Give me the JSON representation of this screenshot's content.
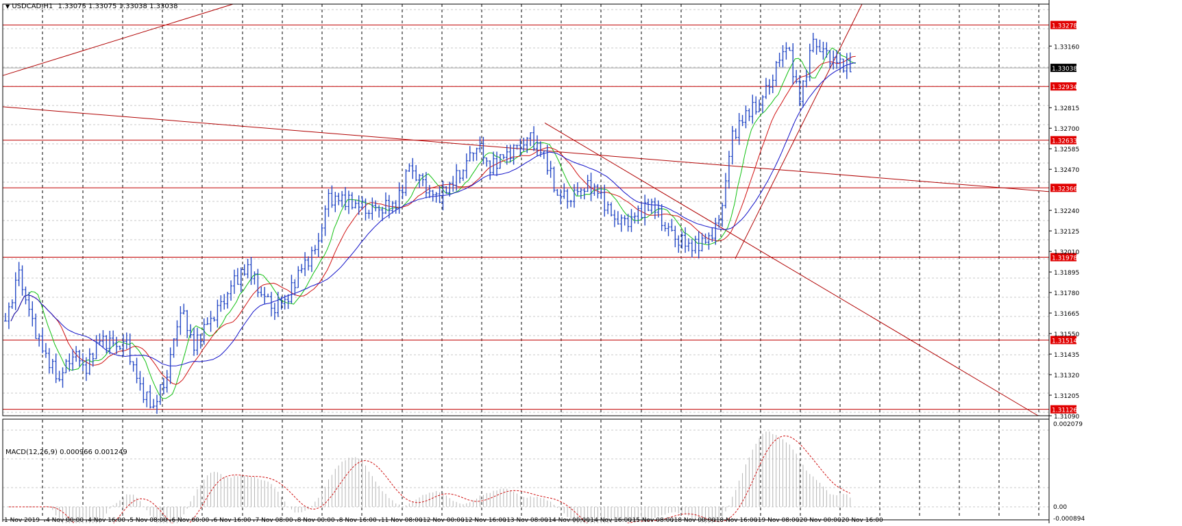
{
  "header": {
    "arrow": "▼",
    "symbol": "USDCAD,H1",
    "ohlc": "1.33075 1.33075 1.33038 1.33038"
  },
  "macd_panel": {
    "label": "MACD(12,26,9) 0.000966 0.001249",
    "scale_labels": [
      "0.002079",
      "0.00",
      "-0.000894"
    ]
  },
  "colors": {
    "candle": "#2448c5",
    "ma_fast": "#10c010",
    "ma_mid": "#d01010",
    "ma_slow": "#1010c8",
    "hline": "#c00000",
    "trend": "#b00000",
    "grid": "#c8c8c8",
    "vgrid": "#000000",
    "current_label_bg": "#000000",
    "hline_label_bg": "#e00000",
    "macd_hist": "#b4b4b4",
    "macd_signal": "#d01010"
  },
  "chart_data": {
    "type": "line",
    "title": "USDCAD,H1",
    "current_price": "1.33038",
    "ylim": [
      1.3109,
      1.33395
    ],
    "price_scale_labels": [
      "1.33160",
      "1.32815",
      "1.32700",
      "1.32585",
      "1.32470",
      "1.32240",
      "1.32125",
      "1.32010",
      "1.31895",
      "1.31780",
      "1.31665",
      "1.31550",
      "1.31435",
      "1.31320",
      "1.31205",
      "1.31090"
    ],
    "horizontal_levels": [
      "1.33278",
      "1.32934",
      "1.32633",
      "1.32366",
      "1.31978",
      "1.31514",
      "1.31126"
    ],
    "time_labels": [
      "1 Nov 2019",
      "4 Nov 00:00",
      "4 Nov 16:00",
      "5 Nov 08:00",
      "6 Nov 00:00",
      "6 Nov 16:00",
      "7 Nov 08:00",
      "8 Nov 00:00",
      "8 Nov 16:00",
      "11 Nov 08:00",
      "12 Nov 00:00",
      "12 Nov 16:00",
      "13 Nov 08:00",
      "14 Nov 00:00",
      "14 Nov 16:00",
      "15 Nov 08:00",
      "18 Nov 00:00",
      "18 Nov 16:00",
      "19 Nov 08:00",
      "20 Nov 00:00",
      "20 Nov 16:00"
    ],
    "price_series": [
      [
        1.3162,
        1.31598
      ],
      [
        1.3188,
        1.3172
      ],
      [
        1.316,
        1.3156
      ],
      [
        1.3142,
        1.3138
      ],
      [
        1.313,
        1.3128
      ],
      [
        1.3145,
        1.3148
      ],
      [
        1.3136,
        1.3138
      ],
      [
        1.3152,
        1.3146
      ],
      [
        1.3148,
        1.3142
      ],
      [
        1.3148,
        1.31495
      ],
      [
        1.3124,
        1.3123
      ],
      [
        1.3114,
        1.311
      ],
      [
        1.3133,
        1.3128
      ],
      [
        1.317,
        1.316
      ],
      [
        1.3148,
        1.3144
      ],
      [
        1.316,
        1.3164
      ],
      [
        1.317,
        1.3172
      ],
      [
        1.3184,
        1.3186
      ],
      [
        1.3192,
        1.319
      ],
      [
        1.3178,
        1.3176
      ],
      [
        1.317,
        1.3166
      ],
      [
        1.3176,
        1.3178
      ],
      [
        1.3192,
        1.3195
      ],
      [
        1.32,
        1.3205
      ],
      [
        1.323,
        1.3235
      ],
      [
        1.323,
        1.3232
      ],
      [
        1.3228,
        1.323
      ],
      [
        1.3225,
        1.3223
      ],
      [
        1.3226,
        1.3224
      ],
      [
        1.3227,
        1.3229
      ],
      [
        1.3248,
        1.3249
      ],
      [
        1.3238,
        1.324
      ],
      [
        1.323,
        1.3232
      ],
      [
        1.3238,
        1.3237
      ],
      [
        1.3248,
        1.325
      ],
      [
        1.3262,
        1.3263
      ],
      [
        1.3248,
        1.325
      ],
      [
        1.3254,
        1.3255
      ],
      [
        1.3258,
        1.326
      ],
      [
        1.3264,
        1.3262
      ],
      [
        1.3255,
        1.3256
      ],
      [
        1.3233,
        1.323
      ],
      [
        1.3232,
        1.323
      ],
      [
        1.3238,
        1.3242
      ],
      [
        1.3235,
        1.323
      ],
      [
        1.322,
        1.3218
      ],
      [
        1.3216,
        1.3216
      ],
      [
        1.3222,
        1.322
      ],
      [
        1.3228,
        1.3227
      ],
      [
        1.3216,
        1.3214
      ],
      [
        1.3208,
        1.3206
      ],
      [
        1.3204,
        1.3204
      ],
      [
        1.3206,
        1.3203
      ],
      [
        1.3216,
        1.3213
      ],
      [
        1.3265,
        1.3268
      ],
      [
        1.3278,
        1.328
      ],
      [
        1.3284,
        1.3285
      ],
      [
        1.33,
        1.3302
      ],
      [
        1.3318,
        1.332
      ],
      [
        1.3286,
        1.3288
      ],
      [
        1.3318,
        1.3322
      ],
      [
        1.331,
        1.3307
      ],
      [
        1.3306,
        1.33038
      ]
    ]
  }
}
